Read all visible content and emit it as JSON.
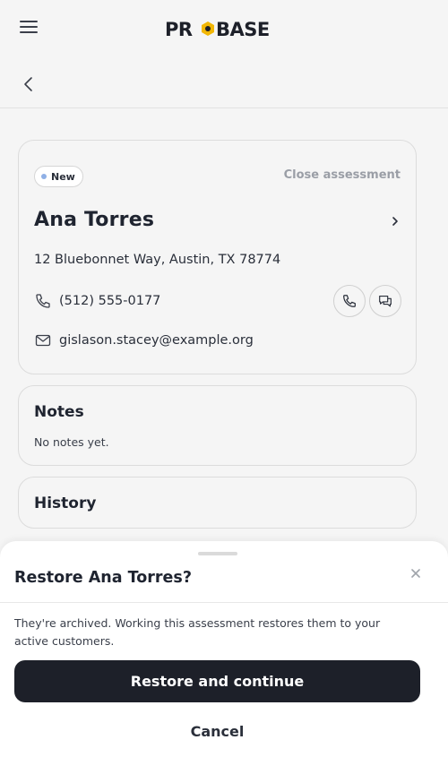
{
  "header": {
    "logo_text": "PROBASE",
    "menu_icon": "hamburger-menu-icon",
    "back_icon": "chevron-left-icon"
  },
  "customer": {
    "status": "New",
    "status_dot_color": "#8fb0e6",
    "close_label": "Close assessment",
    "name": "Ana Torres",
    "address": "12 Bluebonnet Way, Austin, TX 78774",
    "phone": "(512) 555-0177",
    "email": "gislason.stacey@example.org"
  },
  "notes": {
    "title": "Notes",
    "empty_text": "No notes yet."
  },
  "history": {
    "title": "History"
  },
  "sheet": {
    "title": "Restore Ana Torres?",
    "message": "They're archived. Working this assessment restores them to your active customers.",
    "primary_label": "Restore and continue",
    "cancel_label": "Cancel"
  },
  "colors": {
    "primary_button": "#1d2029",
    "logo_accent": "#f2b705"
  }
}
